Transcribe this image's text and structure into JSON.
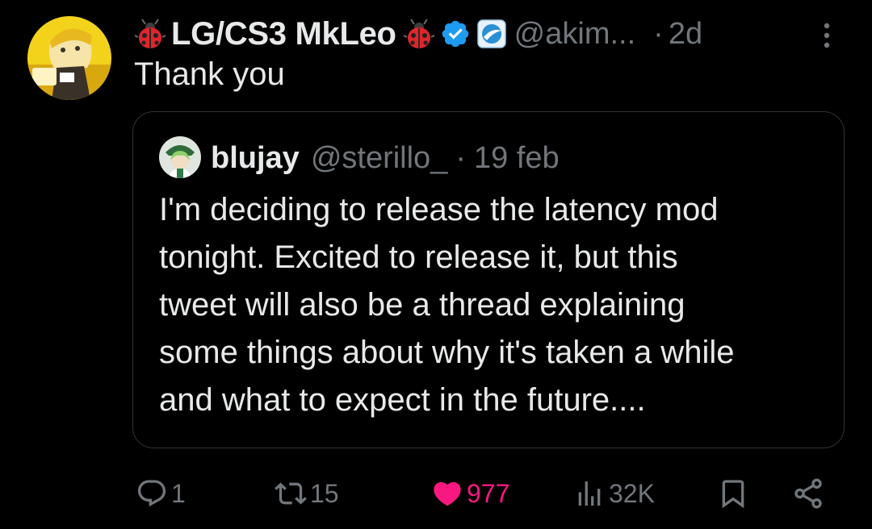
{
  "tweet": {
    "author": {
      "display_name": "LG/CS3 MkLeo",
      "handle": "@akim...",
      "verified": true
    },
    "time": "2d",
    "separator": "·",
    "text": "Thank you"
  },
  "quoted_tweet": {
    "author": {
      "display_name": "blujay",
      "handle": "@sterillo_"
    },
    "separator": "·",
    "time": "19 feb",
    "text_lines": [
      "I'm deciding to release the latency mod",
      "tonight. Excited to release it, but this",
      "tweet will also be a thread explaining",
      "some things about why it's taken a while",
      "and what to expect in the future...."
    ]
  },
  "actions": {
    "replies": "1",
    "reposts": "15",
    "likes": "977",
    "views": "32K"
  },
  "icons": {
    "name_emoji": "ladybug-icon",
    "verified": "verified-badge-icon",
    "affiliation": "affiliate-badge-icon",
    "more": "more-options-icon",
    "reply": "reply-icon",
    "repost": "repost-icon",
    "like": "heart-filled-icon",
    "views": "views-icon",
    "bookmark": "bookmark-icon",
    "share": "share-icon"
  },
  "colors": {
    "background": "#000000",
    "text": "#e7e9ea",
    "muted": "#71767b",
    "border": "#2f3336",
    "verified": "#1d9bf0",
    "like": "#f91880"
  }
}
